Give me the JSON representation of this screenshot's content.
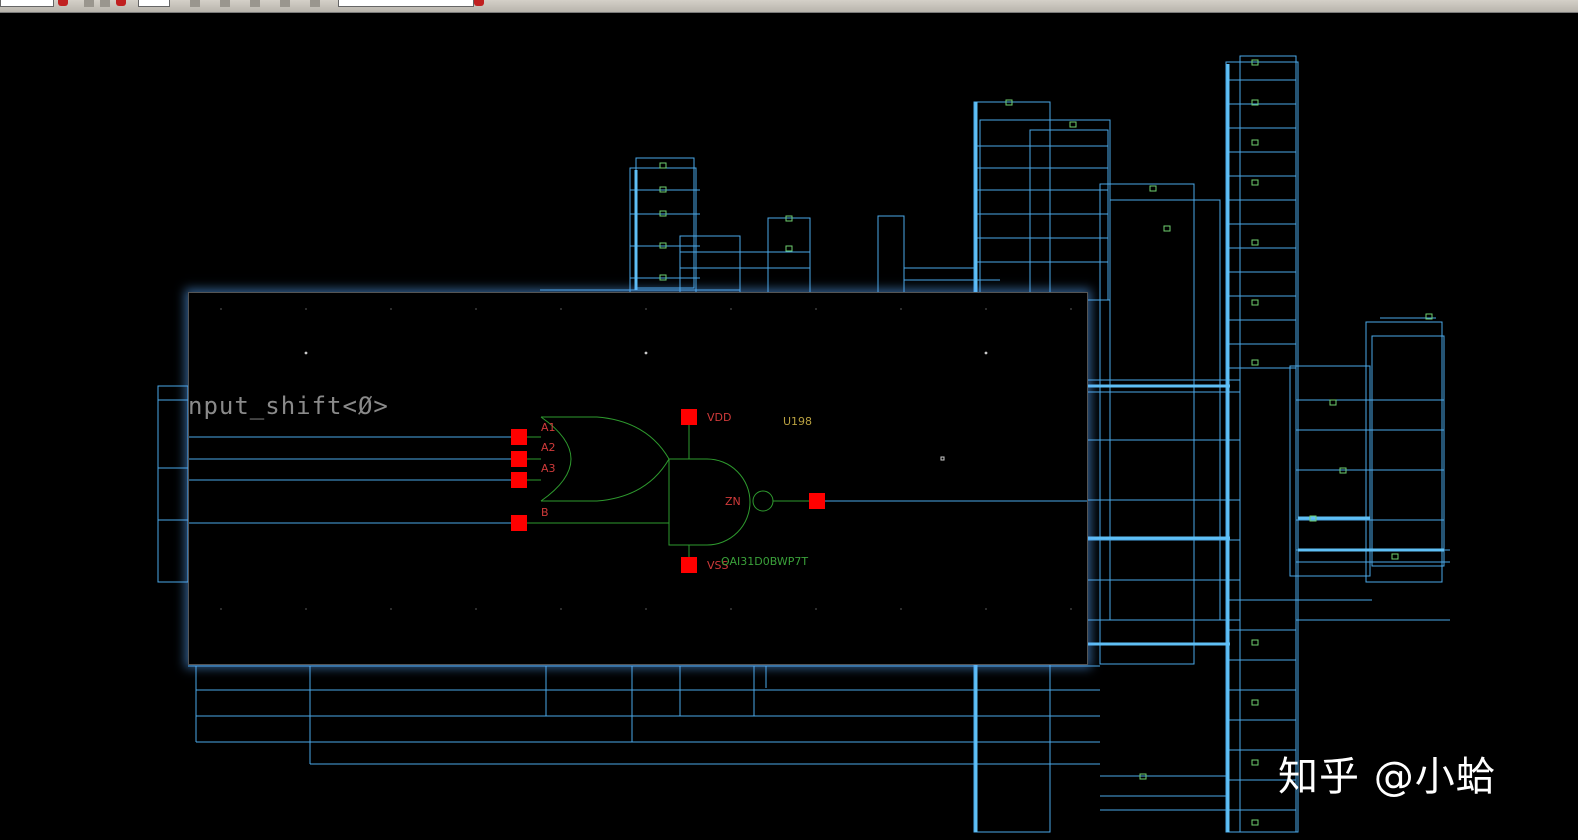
{
  "toolbar": {
    "label": "toolbar"
  },
  "schematic": {
    "net_label": "nput_shift<Ø>",
    "instance_name": "U198",
    "cell_name": "OAI31D0BWP7T",
    "pins": {
      "a1": "A1",
      "a2": "A2",
      "a3": "A3",
      "b": "B",
      "zn": "ZN",
      "vdd": "VDD",
      "vss": "VSS"
    }
  },
  "watermark": "知乎 @小蛤",
  "colors": {
    "background": "#000000",
    "wire": "#4aa8e8",
    "gate": "#2e9a2e",
    "pin": "#ff0000",
    "pin_label": "#d03a3a",
    "net_label": "#8a8a8a"
  }
}
